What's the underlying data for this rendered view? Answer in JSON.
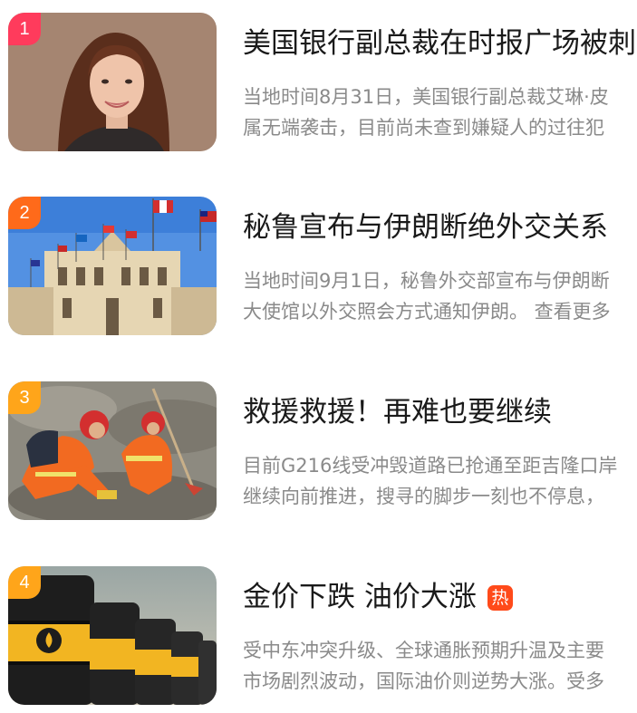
{
  "news": [
    {
      "rank": "1",
      "rank_color": "#ff3b5c",
      "title": "美国银行副总裁在时报广场被刺",
      "tag": "",
      "summary_line1": "当地时间8月31日，美国银行副总裁艾琳·皮",
      "summary_line2": "属无端袭击，目前尚未查到嫌疑人的过往犯",
      "image": "woman-portrait"
    },
    {
      "rank": "2",
      "rank_color": "#ff6a1a",
      "title": "秘鲁宣布与伊朗断绝外交关系",
      "tag": "",
      "summary_line1": "当地时间9月1日，秘鲁外交部宣布与伊朗断",
      "summary_line2": "大使馆以外交照会方式通知伊朗。 查看更多",
      "image": "government-palace-flags"
    },
    {
      "rank": "3",
      "rank_color": "#ffa51a",
      "title": "救援救援！再难也要继续",
      "tag": "",
      "summary_line1": "目前G216线受冲毁道路已抢通至距吉隆口岸",
      "summary_line2": "继续向前推进，搜寻的脚步一刻也不停息，",
      "image": "rescue-workers-mud"
    },
    {
      "rank": "4",
      "rank_color": "#ffa51a",
      "title": "金价下跌 油价大涨",
      "tag": "热",
      "summary_line1": "受中东冲突升级、全球通胀预期升温及主要",
      "summary_line2": "市场剧烈波动，国际油价则逆势大涨。受多",
      "image": "oil-barrels"
    }
  ]
}
